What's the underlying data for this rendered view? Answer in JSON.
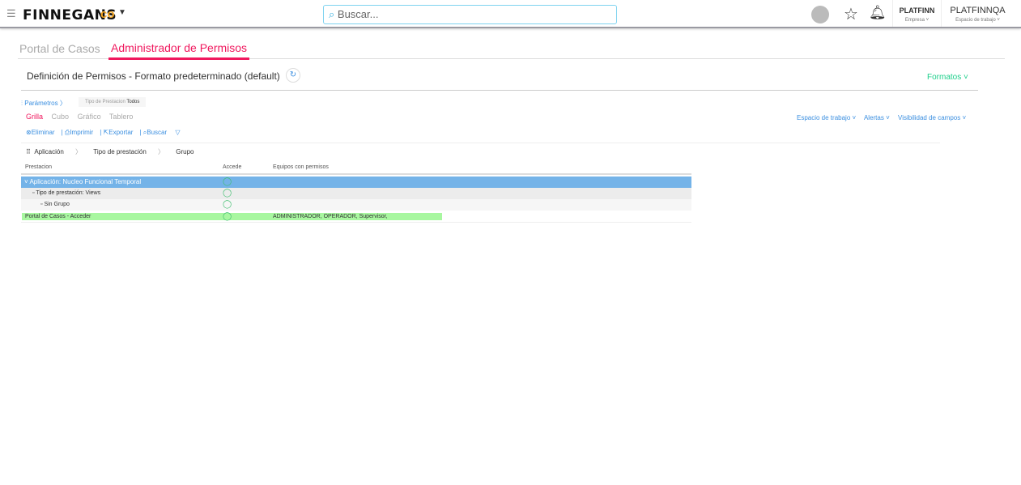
{
  "header": {
    "brand": "FINNEGANS",
    "search_placeholder": "Buscar...",
    "company": "PLATFINN",
    "company_label": "Empresa",
    "workspace": "PLATFINNQA",
    "workspace_label": "Espacio de trabajo"
  },
  "tabs": [
    {
      "label": "Portal de Casos",
      "active": false
    },
    {
      "label": "Administrador de Permisos",
      "active": true
    }
  ],
  "page_title": "Definición de Permisos - Formato predeterminado (default)",
  "formatos": "Formatos",
  "params": {
    "label": "Parámetros",
    "filter_name": "Tipo de Prestacion",
    "filter_value": "Todos"
  },
  "views": [
    "Grilla",
    "Cubo",
    "Gráfico",
    "Tablero"
  ],
  "toolbar": {
    "delete": "Eliminar",
    "print": "Imprimir",
    "export": "Exportar",
    "search": "Buscar"
  },
  "right_menu": [
    "Espacio de trabajo",
    "Alertas",
    "Visibilidad de campos"
  ],
  "groupings": [
    "Aplicación",
    "Tipo de prestación",
    "Grupo"
  ],
  "columns": [
    "Prestacion",
    "Accede",
    "Equipos con permisos"
  ],
  "rows": [
    {
      "label": "Aplicación: Nucleo Funcional Temporal",
      "equipos": ""
    },
    {
      "label": "Tipo de prestación: Views",
      "equipos": ""
    },
    {
      "label": "Sin Grupo",
      "equipos": ""
    },
    {
      "label": "Portal de Casos - Acceder",
      "equipos": "ADMINISTRADOR, OPERADOR, Supervisor,"
    }
  ],
  "colors": {
    "accent": "#f0185e",
    "link": "#3b8fe0",
    "formatos": "#1ccf8a",
    "selected_row": "#74b3e8",
    "green_row": "#a8f7a0"
  }
}
